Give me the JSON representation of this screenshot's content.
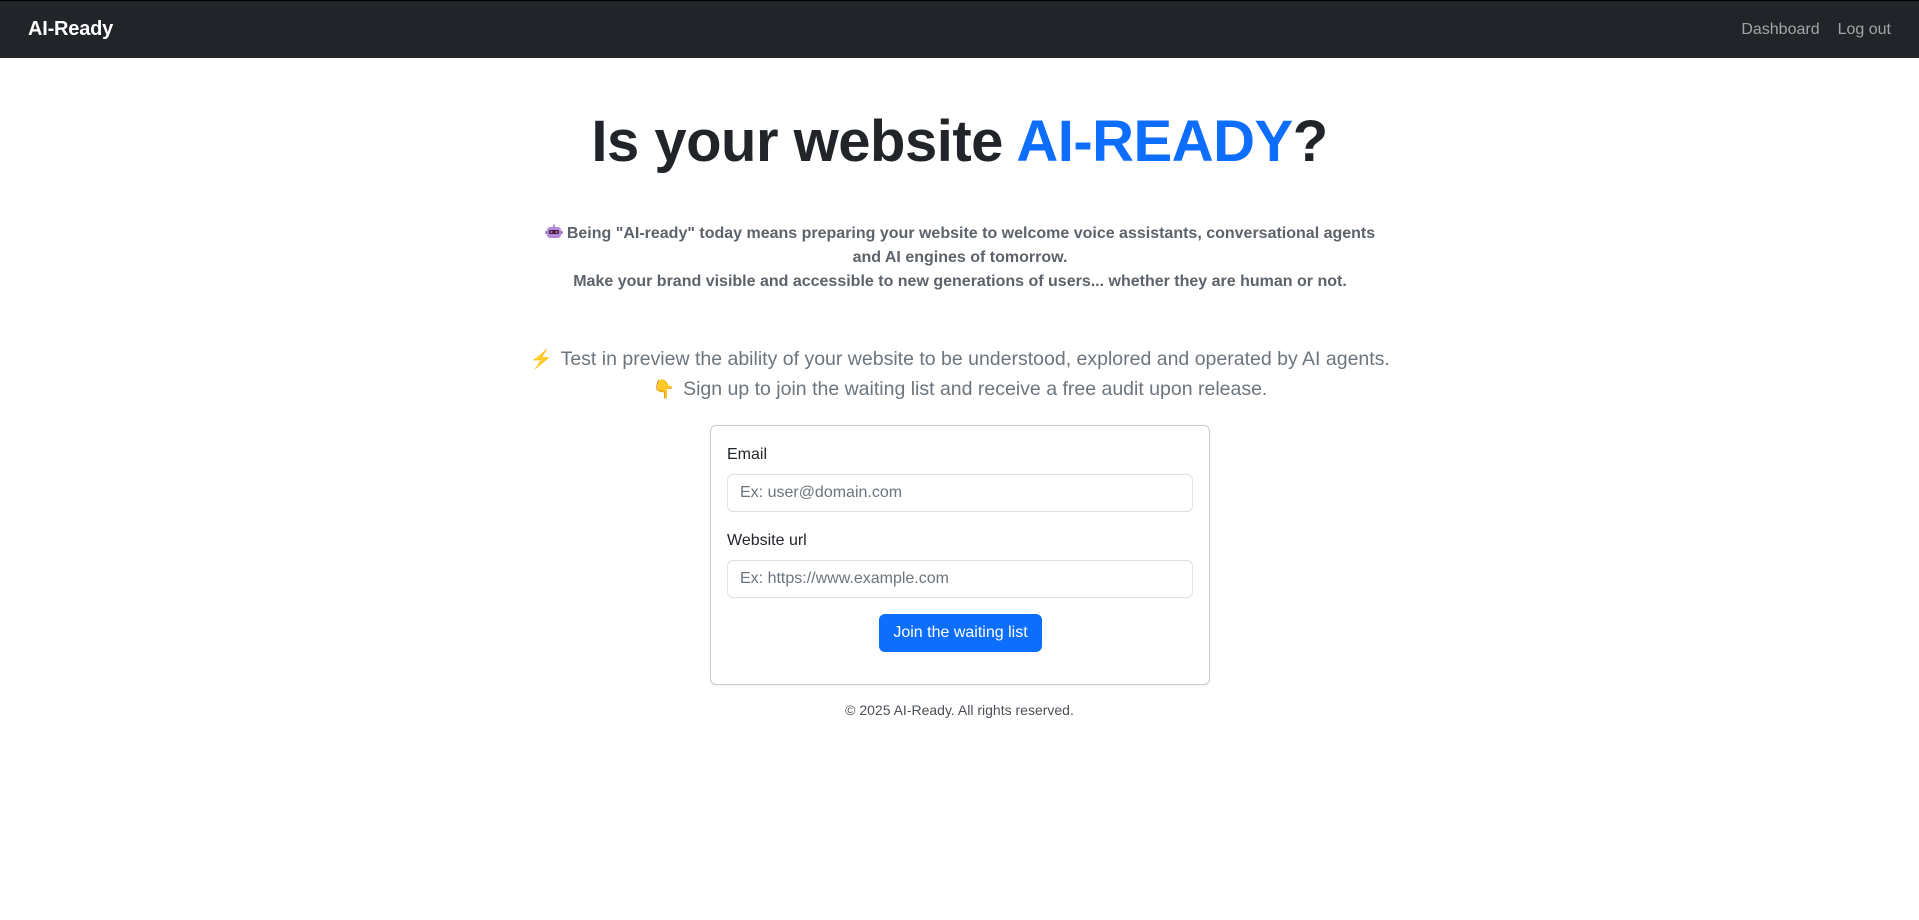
{
  "navbar": {
    "brand": "AI-Ready",
    "links": [
      {
        "label": "Dashboard"
      },
      {
        "label": "Log out"
      }
    ]
  },
  "hero": {
    "title_prefix": "Is your website ",
    "title_accent": "AI-READY",
    "title_suffix": "?",
    "accent_color": "#0d6efd"
  },
  "intro": {
    "icon": "robot-icon",
    "line1": "Being \"AI-ready\" today means preparing your website to welcome voice assistants, conversational agents and AI engines of tomorrow.",
    "line2": "Make your brand visible and accessible to new generations of users... whether they are human or not."
  },
  "lead": {
    "line1_icon": "⚡",
    "line1": "Test in preview the ability of your website to be understood, explored and operated by AI agents.",
    "line2_icon": "👇",
    "line2": "Sign up to join the waiting list and receive a free audit upon release."
  },
  "form": {
    "email_label": "Email",
    "email_placeholder": "Ex: user@domain.com",
    "email_value": "",
    "url_label": "Website url",
    "url_placeholder": "Ex: https://www.example.com",
    "url_value": "",
    "submit_label": "Join the waiting list"
  },
  "footer": {
    "text": "© 2025 AI-Ready. All rights reserved."
  }
}
